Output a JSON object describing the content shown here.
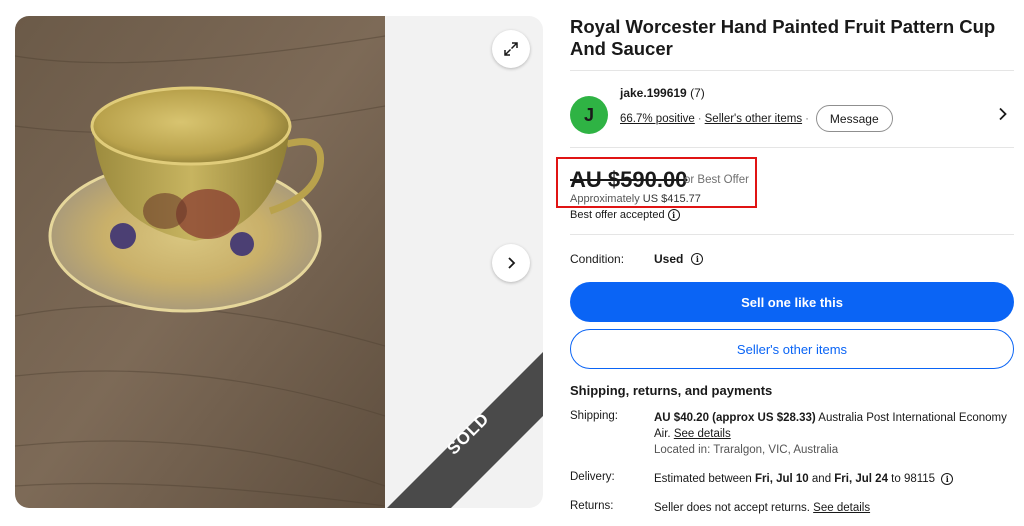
{
  "gallery": {
    "sold_label": "SOLD",
    "expand_icon": "expand-icon",
    "next_icon": "chevron-right-icon"
  },
  "listing": {
    "title": "Royal Worcester Hand Painted Fruit Pattern Cup And Saucer"
  },
  "seller": {
    "avatar_letter": "J",
    "avatar_color": "#2fb344",
    "username": "jake.199619",
    "feedback_count": "(7)",
    "positive": "66.7% positive",
    "separator": "·",
    "other_items": "Seller's other items",
    "message_label": "Message"
  },
  "price": {
    "amount": "AU $590.00",
    "or_best_offer": "or Best Offer",
    "approx_prefix": "Approximately",
    "approx_value": "US $415.77",
    "best_offer_accepted": "Best offer accepted",
    "highlight_color": "#e01414"
  },
  "condition": {
    "label": "Condition:",
    "value": "Used"
  },
  "actions": {
    "sell_one": "Sell one like this",
    "seller_other_items": "Seller's other items",
    "accent": "#0a64f5"
  },
  "shipping": {
    "heading": "Shipping, returns, and payments",
    "rows": {
      "shipping": {
        "label": "Shipping:",
        "bold": "AU $40.20 (approx US $28.33)",
        "text": " Australia Post International Economy Air. ",
        "link": "See details",
        "located": "Located in: Traralgon, VIC, Australia"
      },
      "delivery": {
        "label": "Delivery:",
        "prefix": "Estimated between ",
        "date1": "Fri, Jul 10",
        "and": " and ",
        "date2": "Fri, Jul 24",
        "suffix": " to 98115"
      },
      "returns": {
        "label": "Returns:",
        "text": "Seller does not accept returns. ",
        "link": "See details"
      }
    }
  }
}
